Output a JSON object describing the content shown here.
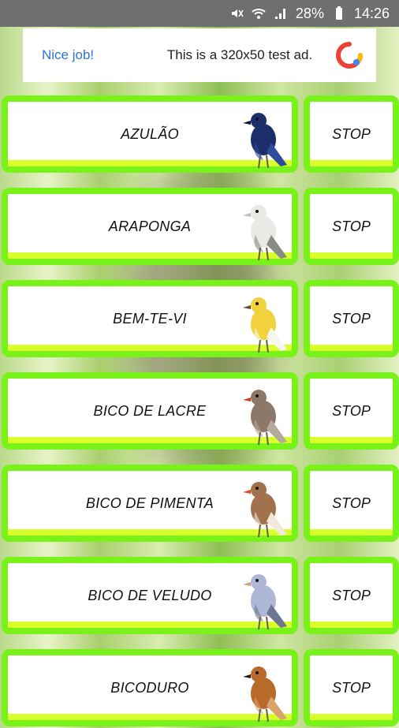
{
  "status": {
    "battery": "28%",
    "time": "14:26"
  },
  "ad": {
    "left_text": "Nice job!",
    "message": "This is a 320x50 test ad."
  },
  "birds": [
    {
      "name": "AZULÃO",
      "stop": "STOP",
      "bird_colors": [
        "#1d2f6a",
        "#0b1533",
        "#2e4c9a"
      ]
    },
    {
      "name": "ARAPONGA",
      "stop": "STOP",
      "bird_colors": [
        "#e9e9e6",
        "#bdbdb8",
        "#8b8b86"
      ]
    },
    {
      "name": "BEM-TE-VI",
      "stop": "STOP",
      "bird_colors": [
        "#f2d23b",
        "#6b4b2a",
        "#f7f7f2"
      ]
    },
    {
      "name": "BICO DE LACRE",
      "stop": "STOP",
      "bird_colors": [
        "#8c7868",
        "#d23a28",
        "#b7a99a"
      ]
    },
    {
      "name": "BICO DE PIMENTA",
      "stop": "STOP",
      "bird_colors": [
        "#a2724e",
        "#e04a1f",
        "#f1e8da"
      ]
    },
    {
      "name": "BICO DE VELUDO",
      "stop": "STOP",
      "bird_colors": [
        "#aeb8d6",
        "#d59a82",
        "#6e7790"
      ]
    },
    {
      "name": "BICODURO",
      "stop": "STOP",
      "bird_colors": [
        "#b86a2b",
        "#2a1b12",
        "#d8a46c"
      ]
    }
  ]
}
